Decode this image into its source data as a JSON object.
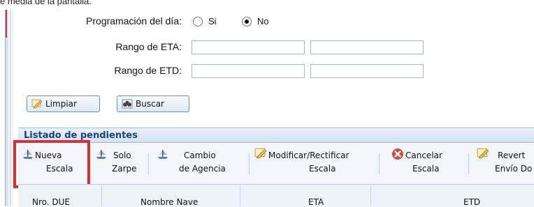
{
  "page": {
    "top_text": "e media de la pantalla."
  },
  "form": {
    "programacion_label": "Programación del día:",
    "radio_si": "Si",
    "radio_no": "No",
    "radio_selected": "No",
    "rango_eta_label": "Rango de ETA:",
    "rango_etd_label": "Rango de ETD:",
    "eta_from": "",
    "eta_to": "",
    "etd_from": "",
    "etd_to": ""
  },
  "actions": {
    "limpiar": "Limpiar",
    "buscar": "Buscar"
  },
  "panel": {
    "title": "Listado de pendientes"
  },
  "toolbar": {
    "nueva_l1": "Nueva",
    "nueva_l2": "Escala",
    "solo_l1": "Solo",
    "solo_l2": "Zarpe",
    "cambio_l1": "Cambio",
    "cambio_l2": "de Agencia",
    "modificar_l1": "Modificar/Rectificar",
    "modificar_l2": "Escala",
    "cancelar_l1": "Cancelar",
    "cancelar_l2": "Escala",
    "revert_l1": "Revert",
    "revert_l2": "Envío Do"
  },
  "table": {
    "columns": [
      "Nro. DUE",
      "Nombre Nave",
      "ETA",
      "ETD"
    ]
  },
  "colors": {
    "highlight": "#e02d33",
    "panel_title": "#15428b",
    "cancel_icon": "#e0453c"
  }
}
